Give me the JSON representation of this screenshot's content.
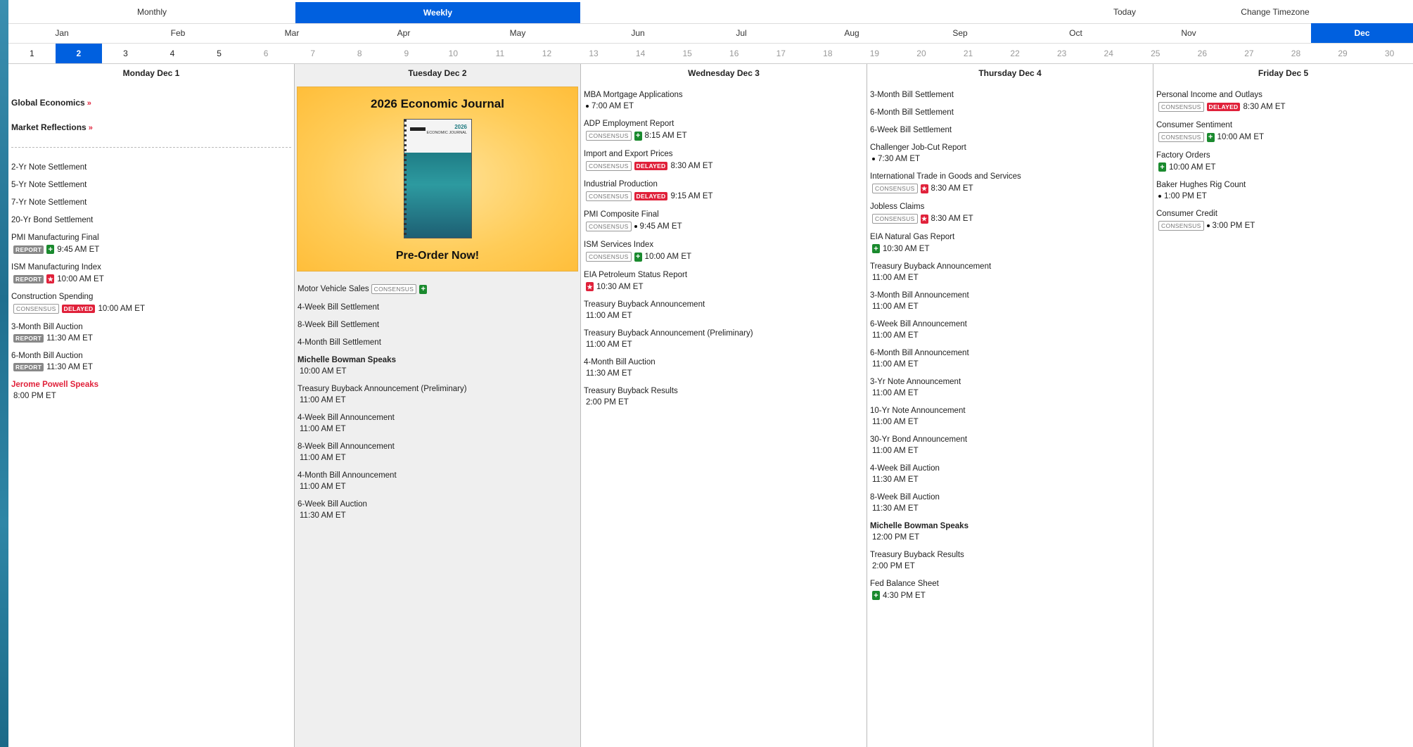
{
  "topbar": {
    "monthly": "Monthly",
    "weekly": "Weekly",
    "today": "Today",
    "timezone": "Change Timezone"
  },
  "months": [
    "Jan",
    "Feb",
    "Mar",
    "Apr",
    "May",
    "Jun",
    "Jul",
    "Aug",
    "Sep",
    "Oct",
    "Nov",
    "Dec"
  ],
  "active_month": "Dec",
  "days": [
    "1",
    "2",
    "3",
    "4",
    "5",
    "6",
    "7",
    "8",
    "9",
    "10",
    "11",
    "12",
    "13",
    "14",
    "15",
    "16",
    "17",
    "18",
    "19",
    "20",
    "21",
    "22",
    "23",
    "24",
    "25",
    "26",
    "27",
    "28",
    "29",
    "30"
  ],
  "active_day": "2",
  "columns": [
    {
      "header": "Monday Dec 1",
      "specials": [
        "Global Economics",
        "Market Reflections"
      ],
      "events": [
        {
          "name": "2-Yr Note Settlement",
          "line": []
        },
        {
          "name": "5-Yr Note Settlement",
          "line": []
        },
        {
          "name": "7-Yr Note Settlement",
          "line": []
        },
        {
          "name": "20-Yr Bond Settlement",
          "line": []
        },
        {
          "name": "PMI Manufacturing Final",
          "line": [
            {
              "t": "badge",
              "k": "report",
              "v": "REPORT"
            },
            {
              "t": "ico",
              "k": "green"
            },
            {
              "t": "time",
              "v": "9:45 AM ET"
            }
          ]
        },
        {
          "name": "ISM Manufacturing Index",
          "line": [
            {
              "t": "badge",
              "k": "report",
              "v": "REPORT"
            },
            {
              "t": "ico",
              "k": "red"
            },
            {
              "t": "time",
              "v": "10:00 AM ET"
            }
          ]
        },
        {
          "name": "Construction Spending",
          "line": [
            {
              "t": "badge",
              "k": "consensus",
              "v": "CONSENSUS"
            },
            {
              "t": "badge",
              "k": "delayed",
              "v": "DELAYED"
            },
            {
              "t": "time",
              "v": "10:00 AM ET"
            }
          ]
        },
        {
          "name": "3-Month Bill Auction",
          "line": [
            {
              "t": "badge",
              "k": "report",
              "v": "REPORT"
            },
            {
              "t": "time",
              "v": "11:30 AM ET"
            }
          ]
        },
        {
          "name": "6-Month Bill Auction",
          "line": [
            {
              "t": "badge",
              "k": "report",
              "v": "REPORT"
            },
            {
              "t": "time",
              "v": "11:30 AM ET"
            }
          ]
        },
        {
          "name": "Jerome Powell Speaks",
          "style": "red",
          "line": [
            {
              "t": "time",
              "v": "8:00 PM ET"
            }
          ]
        }
      ]
    },
    {
      "header": "Tuesday Dec 2",
      "promo": {
        "title": "2026 Economic Journal",
        "cta": "Pre-Order Now!",
        "book_title": "2026",
        "book_sub": "ECONOMIC JOURNAL"
      },
      "events": [
        {
          "name": "Motor Vehicle Sales",
          "inline": true,
          "line": [
            {
              "t": "badge",
              "k": "consensus",
              "v": "CONSENSUS"
            },
            {
              "t": "ico",
              "k": "green"
            }
          ]
        },
        {
          "name": "4-Week Bill Settlement",
          "line": []
        },
        {
          "name": "8-Week Bill Settlement",
          "line": []
        },
        {
          "name": "4-Month Bill Settlement",
          "line": []
        },
        {
          "name": "Michelle Bowman Speaks",
          "style": "bold",
          "line": [
            {
              "t": "time",
              "v": "10:00 AM ET"
            }
          ]
        },
        {
          "name": "Treasury Buyback Announcement (Preliminary)",
          "line": [
            {
              "t": "time",
              "v": "11:00 AM ET"
            }
          ]
        },
        {
          "name": "4-Week Bill Announcement",
          "line": [
            {
              "t": "time",
              "v": "11:00 AM ET"
            }
          ]
        },
        {
          "name": "8-Week Bill Announcement",
          "line": [
            {
              "t": "time",
              "v": "11:00 AM ET"
            }
          ]
        },
        {
          "name": "4-Month Bill Announcement",
          "line": [
            {
              "t": "time",
              "v": "11:00 AM ET"
            }
          ]
        },
        {
          "name": "6-Week Bill Auction",
          "line": [
            {
              "t": "time",
              "v": "11:30 AM ET"
            }
          ]
        }
      ]
    },
    {
      "header": "Wednesday Dec 3",
      "events": [
        {
          "name": "MBA Mortgage Applications",
          "line": [
            {
              "t": "dot"
            },
            {
              "t": "time",
              "v": "7:00 AM ET"
            }
          ]
        },
        {
          "name": "ADP Employment Report",
          "line": [
            {
              "t": "badge",
              "k": "consensus",
              "v": "CONSENSUS"
            },
            {
              "t": "ico",
              "k": "green"
            },
            {
              "t": "time",
              "v": "8:15 AM ET"
            }
          ]
        },
        {
          "name": "Import and Export Prices",
          "line": [
            {
              "t": "badge",
              "k": "consensus",
              "v": "CONSENSUS"
            },
            {
              "t": "badge",
              "k": "delayed",
              "v": "DELAYED"
            },
            {
              "t": "time",
              "v": "8:30 AM ET"
            }
          ]
        },
        {
          "name": "Industrial Production",
          "line": [
            {
              "t": "badge",
              "k": "consensus",
              "v": "CONSENSUS"
            },
            {
              "t": "badge",
              "k": "delayed",
              "v": "DELAYED"
            },
            {
              "t": "time",
              "v": "9:15 AM ET"
            }
          ]
        },
        {
          "name": "PMI Composite Final",
          "line": [
            {
              "t": "badge",
              "k": "consensus",
              "v": "CONSENSUS"
            },
            {
              "t": "dot"
            },
            {
              "t": "time",
              "v": "9:45 AM ET"
            }
          ]
        },
        {
          "name": "ISM Services Index",
          "line": [
            {
              "t": "badge",
              "k": "consensus",
              "v": "CONSENSUS"
            },
            {
              "t": "ico",
              "k": "green"
            },
            {
              "t": "time",
              "v": "10:00 AM ET"
            }
          ]
        },
        {
          "name": "EIA Petroleum Status Report",
          "line": [
            {
              "t": "ico",
              "k": "red"
            },
            {
              "t": "time",
              "v": "10:30 AM ET"
            }
          ]
        },
        {
          "name": "Treasury Buyback Announcement",
          "line": [
            {
              "t": "time",
              "v": "11:00 AM ET"
            }
          ]
        },
        {
          "name": "Treasury Buyback Announcement (Preliminary)",
          "line": [
            {
              "t": "time",
              "v": "11:00 AM ET"
            }
          ]
        },
        {
          "name": "4-Month Bill Auction",
          "line": [
            {
              "t": "time",
              "v": "11:30 AM ET"
            }
          ]
        },
        {
          "name": "Treasury Buyback Results",
          "line": [
            {
              "t": "time",
              "v": "2:00 PM ET"
            }
          ]
        }
      ]
    },
    {
      "header": "Thursday Dec 4",
      "events": [
        {
          "name": "3-Month Bill Settlement",
          "line": []
        },
        {
          "name": "6-Month Bill Settlement",
          "line": []
        },
        {
          "name": "6-Week Bill Settlement",
          "line": []
        },
        {
          "name": "Challenger Job-Cut Report",
          "line": [
            {
              "t": "dot"
            },
            {
              "t": "time",
              "v": "7:30 AM ET"
            }
          ]
        },
        {
          "name": "International Trade in Goods and Services",
          "line": [
            {
              "t": "badge",
              "k": "consensus",
              "v": "CONSENSUS"
            },
            {
              "t": "ico",
              "k": "red"
            },
            {
              "t": "time",
              "v": "8:30 AM ET"
            }
          ]
        },
        {
          "name": "Jobless Claims",
          "line": [
            {
              "t": "badge",
              "k": "consensus",
              "v": "CONSENSUS"
            },
            {
              "t": "ico",
              "k": "red"
            },
            {
              "t": "time",
              "v": "8:30 AM ET"
            }
          ]
        },
        {
          "name": "EIA Natural Gas Report",
          "line": [
            {
              "t": "ico",
              "k": "green"
            },
            {
              "t": "time",
              "v": "10:30 AM ET"
            }
          ]
        },
        {
          "name": "Treasury Buyback Announcement",
          "line": [
            {
              "t": "time",
              "v": "11:00 AM ET"
            }
          ]
        },
        {
          "name": "3-Month Bill Announcement",
          "line": [
            {
              "t": "time",
              "v": "11:00 AM ET"
            }
          ]
        },
        {
          "name": "6-Week Bill Announcement",
          "line": [
            {
              "t": "time",
              "v": "11:00 AM ET"
            }
          ]
        },
        {
          "name": "6-Month Bill Announcement",
          "line": [
            {
              "t": "time",
              "v": "11:00 AM ET"
            }
          ]
        },
        {
          "name": "3-Yr Note Announcement",
          "line": [
            {
              "t": "time",
              "v": "11:00 AM ET"
            }
          ]
        },
        {
          "name": "10-Yr Note Announcement",
          "line": [
            {
              "t": "time",
              "v": "11:00 AM ET"
            }
          ]
        },
        {
          "name": "30-Yr Bond Announcement",
          "line": [
            {
              "t": "time",
              "v": "11:00 AM ET"
            }
          ]
        },
        {
          "name": "4-Week Bill Auction",
          "line": [
            {
              "t": "time",
              "v": "11:30 AM ET"
            }
          ]
        },
        {
          "name": "8-Week Bill Auction",
          "line": [
            {
              "t": "time",
              "v": "11:30 AM ET"
            }
          ]
        },
        {
          "name": "Michelle Bowman Speaks",
          "style": "bold",
          "line": [
            {
              "t": "time",
              "v": "12:00 PM ET"
            }
          ]
        },
        {
          "name": "Treasury Buyback Results",
          "line": [
            {
              "t": "time",
              "v": "2:00 PM ET"
            }
          ]
        },
        {
          "name": "Fed Balance Sheet",
          "line": [
            {
              "t": "ico",
              "k": "green"
            },
            {
              "t": "time",
              "v": "4:30 PM ET"
            }
          ]
        }
      ]
    },
    {
      "header": "Friday Dec 5",
      "events": [
        {
          "name": "Personal Income and Outlays",
          "line": [
            {
              "t": "badge",
              "k": "consensus",
              "v": "CONSENSUS"
            },
            {
              "t": "badge",
              "k": "delayed",
              "v": "DELAYED"
            },
            {
              "t": "time",
              "v": "8:30 AM ET"
            }
          ]
        },
        {
          "name": "Consumer Sentiment",
          "line": [
            {
              "t": "badge",
              "k": "consensus",
              "v": "CONSENSUS"
            },
            {
              "t": "ico",
              "k": "green"
            },
            {
              "t": "time",
              "v": "10:00 AM ET"
            }
          ]
        },
        {
          "name": "Factory Orders",
          "line": [
            {
              "t": "ico",
              "k": "green"
            },
            {
              "t": "time",
              "v": "10:00 AM ET"
            }
          ]
        },
        {
          "name": "Baker Hughes Rig Count",
          "line": [
            {
              "t": "dot"
            },
            {
              "t": "time",
              "v": "1:00 PM ET"
            }
          ]
        },
        {
          "name": "Consumer Credit",
          "line": [
            {
              "t": "badge",
              "k": "consensus",
              "v": "CONSENSUS"
            },
            {
              "t": "dot"
            },
            {
              "t": "time",
              "v": "3:00 PM ET"
            }
          ]
        }
      ]
    }
  ],
  "colors": {
    "accent": "#0060df",
    "delayed": "#e0213a",
    "green_icon": "#1a8a2e"
  }
}
